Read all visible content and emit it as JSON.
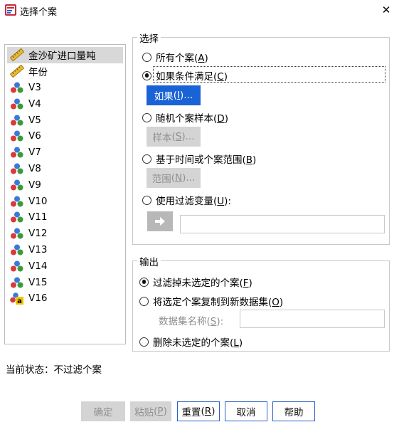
{
  "window": {
    "title": "选择个案",
    "close_glyph": "✕"
  },
  "variables": [
    {
      "name": "金沙矿进口量吨",
      "icon": "ruler-icon",
      "selected": true
    },
    {
      "name": "年份",
      "icon": "ruler-icon",
      "selected": false
    },
    {
      "name": "V3",
      "icon": "nominal-balls-icon"
    },
    {
      "name": "V4",
      "icon": "nominal-balls-icon"
    },
    {
      "name": "V5",
      "icon": "nominal-balls-icon"
    },
    {
      "name": "V6",
      "icon": "nominal-balls-icon"
    },
    {
      "name": "V7",
      "icon": "nominal-balls-icon"
    },
    {
      "name": "V8",
      "icon": "nominal-balls-icon"
    },
    {
      "name": "V9",
      "icon": "nominal-balls-icon"
    },
    {
      "name": "V10",
      "icon": "nominal-balls-icon"
    },
    {
      "name": "V11",
      "icon": "nominal-balls-icon"
    },
    {
      "name": "V12",
      "icon": "nominal-balls-icon"
    },
    {
      "name": "V13",
      "icon": "nominal-balls-icon"
    },
    {
      "name": "V14",
      "icon": "nominal-balls-icon"
    },
    {
      "name": "V15",
      "icon": "nominal-balls-icon"
    },
    {
      "name": "V16",
      "icon": "string-nominal-icon"
    }
  ],
  "select_group": {
    "title": "选择",
    "all_cases": {
      "label": "所有个案",
      "key": "A",
      "checked": false
    },
    "if_condition": {
      "label": "如果条件满足",
      "key": "C",
      "checked": true
    },
    "if_button": {
      "label": "如果",
      "key": "I",
      "suffix": "..."
    },
    "random_sample": {
      "label": "随机个案样本",
      "key": "D",
      "checked": false
    },
    "sample_button": {
      "label": "样本",
      "key": "S",
      "suffix": "..."
    },
    "time_range": {
      "label": "基于时间或个案范围",
      "key": "B",
      "checked": false
    },
    "range_button": {
      "label": "范围",
      "key": "N",
      "suffix": "..."
    },
    "filter_var": {
      "label": "使用过滤变量",
      "key": "U",
      "suffix": ":",
      "checked": false
    },
    "filter_value": ""
  },
  "output_group": {
    "title": "输出",
    "filter_out": {
      "label": "过滤掉未选定的个案",
      "key": "F",
      "checked": true
    },
    "copy_new": {
      "label": "将选定个案复制到新数据集",
      "key": "O",
      "checked": false
    },
    "dataset_name_label": "数据集名称",
    "dataset_name_key": "S",
    "dataset_name_suffix": ":",
    "dataset_name_value": "",
    "delete_unselected": {
      "label": "删除未选定的个案",
      "key": "L",
      "checked": false
    }
  },
  "status": "当前状态：不过滤个案",
  "buttons": {
    "ok": "确定",
    "paste": {
      "label": "粘贴",
      "key": "P"
    },
    "reset": {
      "label": "重置",
      "key": "R"
    },
    "cancel": "取消",
    "help": "帮助"
  },
  "colors": {
    "accent": "#1a63d6",
    "disabled_bg": "#d4d4d4",
    "selected_row": "#d8d8d8"
  }
}
